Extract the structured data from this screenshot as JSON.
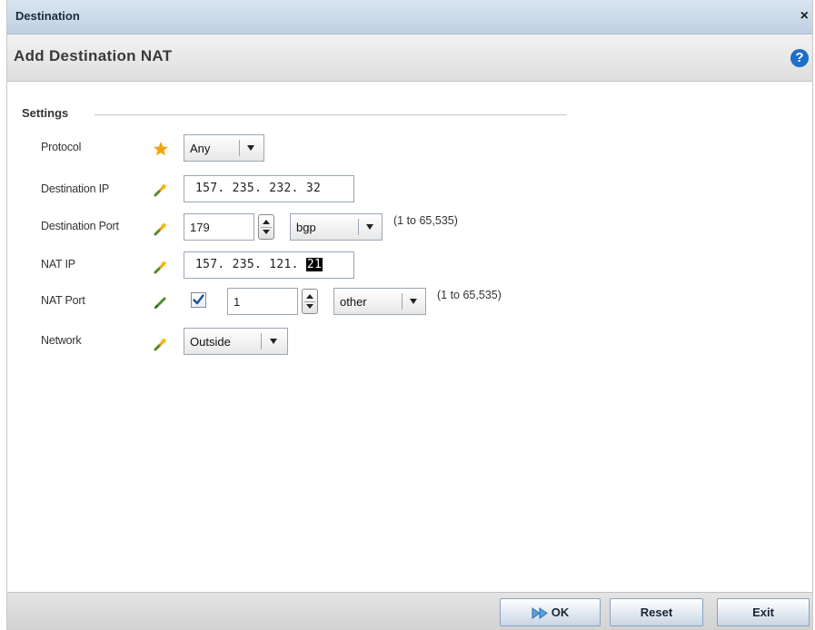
{
  "window": {
    "title": "Destination",
    "close_glyph": "×"
  },
  "header": {
    "title": "Add Destination NAT",
    "help_glyph": "?"
  },
  "settings": {
    "group_title": "Settings",
    "protocol": {
      "label": "Protocol",
      "value": "Any",
      "marker": "required-star-icon"
    },
    "destination_ip": {
      "label": "Destination IP",
      "value": "157. 235. 232. 32",
      "marker": "edit-wand-icon"
    },
    "destination_port": {
      "label": "Destination Port",
      "value": "179",
      "service": "bgp",
      "range": "(1 to 65,535)",
      "marker": "edit-wand-icon"
    },
    "nat_ip": {
      "label": "NAT IP",
      "value_prefix": "157. 235. 121. ",
      "value_selected": "21",
      "marker": "edit-wand-icon"
    },
    "nat_port": {
      "label": "NAT Port",
      "checked": true,
      "value": "1",
      "service": "other",
      "range": "(1 to 65,535)",
      "marker": "edit-pencil-icon"
    },
    "network": {
      "label": "Network",
      "value": "Outside",
      "marker": "edit-wand-icon"
    }
  },
  "footer": {
    "ok_label": "OK",
    "reset_label": "Reset",
    "exit_label": "Exit"
  },
  "colors": {
    "title_bar": "#c9d8e6",
    "help_icon": "#1d6fc8",
    "required_star": "#f5a20a",
    "edit_icon": "#e8a317"
  }
}
